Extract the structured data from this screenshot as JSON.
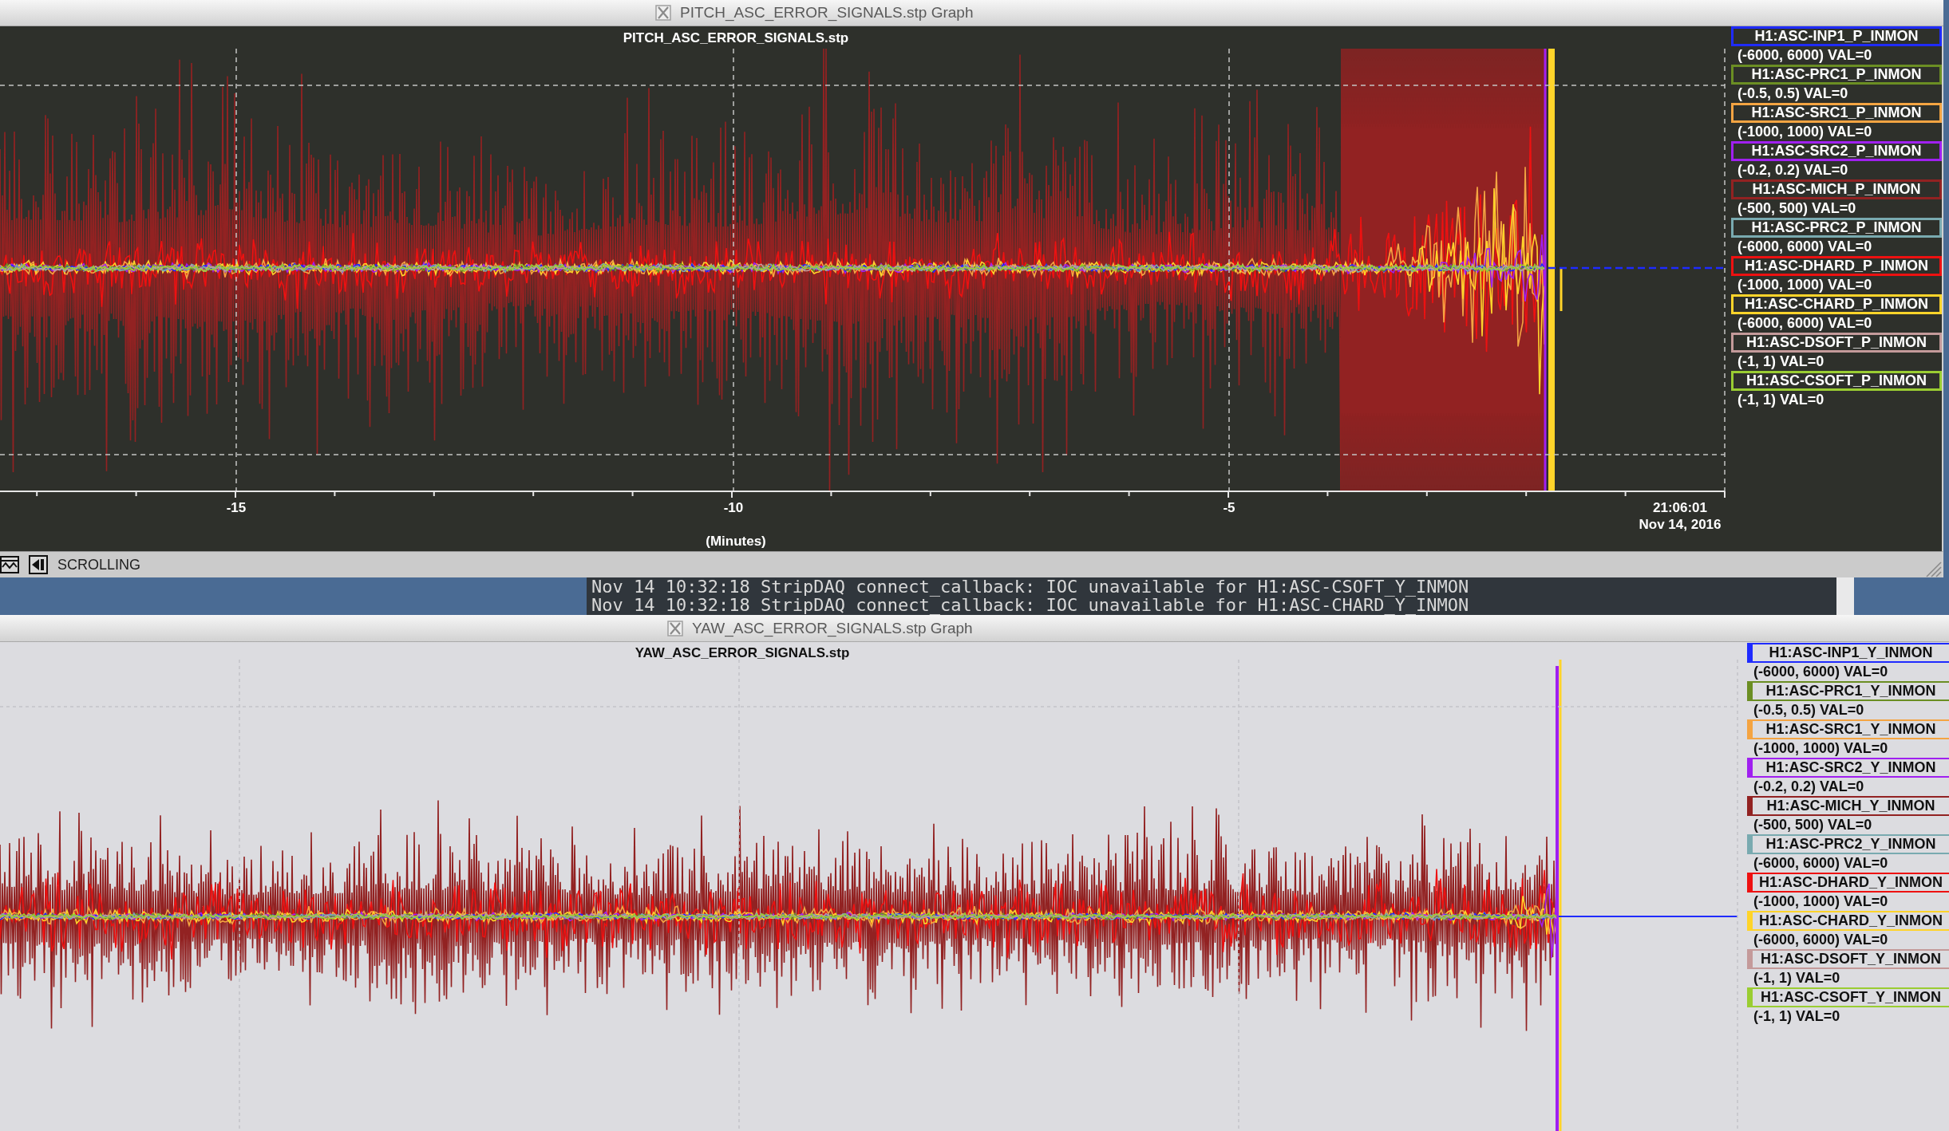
{
  "top_window": {
    "kind": "dark",
    "title": "PITCH_ASC_ERROR_SIGNALS.stp Graph",
    "plot_title": "PITCH_ASC_ERROR_SIGNALS.stp",
    "legend": [
      {
        "name": "H1:ASC-INP1_P_INMON",
        "reading": "(-6000, 6000) VAL=0",
        "color": "#1f2bff"
      },
      {
        "name": "H1:ASC-PRC1_P_INMON",
        "reading": "(-0.5, 0.5) VAL=0",
        "color": "#6b8e23"
      },
      {
        "name": "H1:ASC-SRC1_P_INMON",
        "reading": "(-1000, 1000) VAL=0",
        "color": "#f4a442"
      },
      {
        "name": "H1:ASC-SRC2_P_INMON",
        "reading": "(-0.2, 0.2) VAL=0",
        "color": "#a020f0"
      },
      {
        "name": "H1:ASC-MICH_P_INMON",
        "reading": "(-500, 500) VAL=0",
        "color": "#922222"
      },
      {
        "name": "H1:ASC-PRC2_P_INMON",
        "reading": "(-6000, 6000) VAL=0",
        "color": "#79aab0"
      },
      {
        "name": "H1:ASC-DHARD_P_INMON",
        "reading": "(-1000, 1000) VAL=0",
        "color": "#ee1111"
      },
      {
        "name": "H1:ASC-CHARD_P_INMON",
        "reading": "(-6000, 6000) VAL=0",
        "color": "#ffd42a"
      },
      {
        "name": "H1:ASC-DSOFT_P_INMON",
        "reading": "(-1, 1) VAL=0",
        "color": "#c49a9a"
      },
      {
        "name": "H1:ASC-CSOFT_P_INMON",
        "reading": "(-1, 1) VAL=0",
        "color": "#9acd32"
      }
    ],
    "x_axis": {
      "ticks": [
        "-15",
        "-10",
        "-5"
      ],
      "end_time": "21:06:01",
      "end_date": "Nov 14, 2016",
      "label": "(Minutes)"
    },
    "status_bar": {
      "mode": "SCROLLING"
    }
  },
  "terminal": {
    "lines": [
      "Nov 14 10:32:18 StripDAQ connect_callback: IOC unavailable for H1:ASC-CSOFT_Y_INMON",
      "Nov 14 10:32:18 StripDAQ connect_callback: IOC unavailable for H1:ASC-CHARD_Y_INMON"
    ]
  },
  "bottom_window": {
    "kind": "light",
    "title": "YAW_ASC_ERROR_SIGNALS.stp Graph",
    "plot_title": "YAW_ASC_ERROR_SIGNALS.stp",
    "legend": [
      {
        "name": "H1:ASC-INP1_Y_INMON",
        "reading": "(-6000, 6000) VAL=0",
        "color": "#1f2bff"
      },
      {
        "name": "H1:ASC-PRC1_Y_INMON",
        "reading": "(-0.5, 0.5) VAL=0",
        "color": "#6b8e23"
      },
      {
        "name": "H1:ASC-SRC1_Y_INMON",
        "reading": "(-1000, 1000) VAL=0",
        "color": "#f4a442"
      },
      {
        "name": "H1:ASC-SRC2_Y_INMON",
        "reading": "(-0.2, 0.2) VAL=0",
        "color": "#a020f0"
      },
      {
        "name": "H1:ASC-MICH_Y_INMON",
        "reading": "(-500, 500) VAL=0",
        "color": "#922222"
      },
      {
        "name": "H1:ASC-PRC2_Y_INMON",
        "reading": "(-6000, 6000) VAL=0",
        "color": "#79aab0"
      },
      {
        "name": "H1:ASC-DHARD_Y_INMON",
        "reading": "(-1000, 1000) VAL=0",
        "color": "#ee1111"
      },
      {
        "name": "H1:ASC-CHARD_Y_INMON",
        "reading": "(-6000, 6000) VAL=0",
        "color": "#ffd42a"
      },
      {
        "name": "H1:ASC-DSOFT_Y_INMON",
        "reading": "(-1, 1) VAL=0",
        "color": "#c49a9a"
      },
      {
        "name": "H1:ASC-CSOFT_Y_INMON",
        "reading": "(-1, 1) VAL=0",
        "color": "#9acd32"
      }
    ]
  }
}
